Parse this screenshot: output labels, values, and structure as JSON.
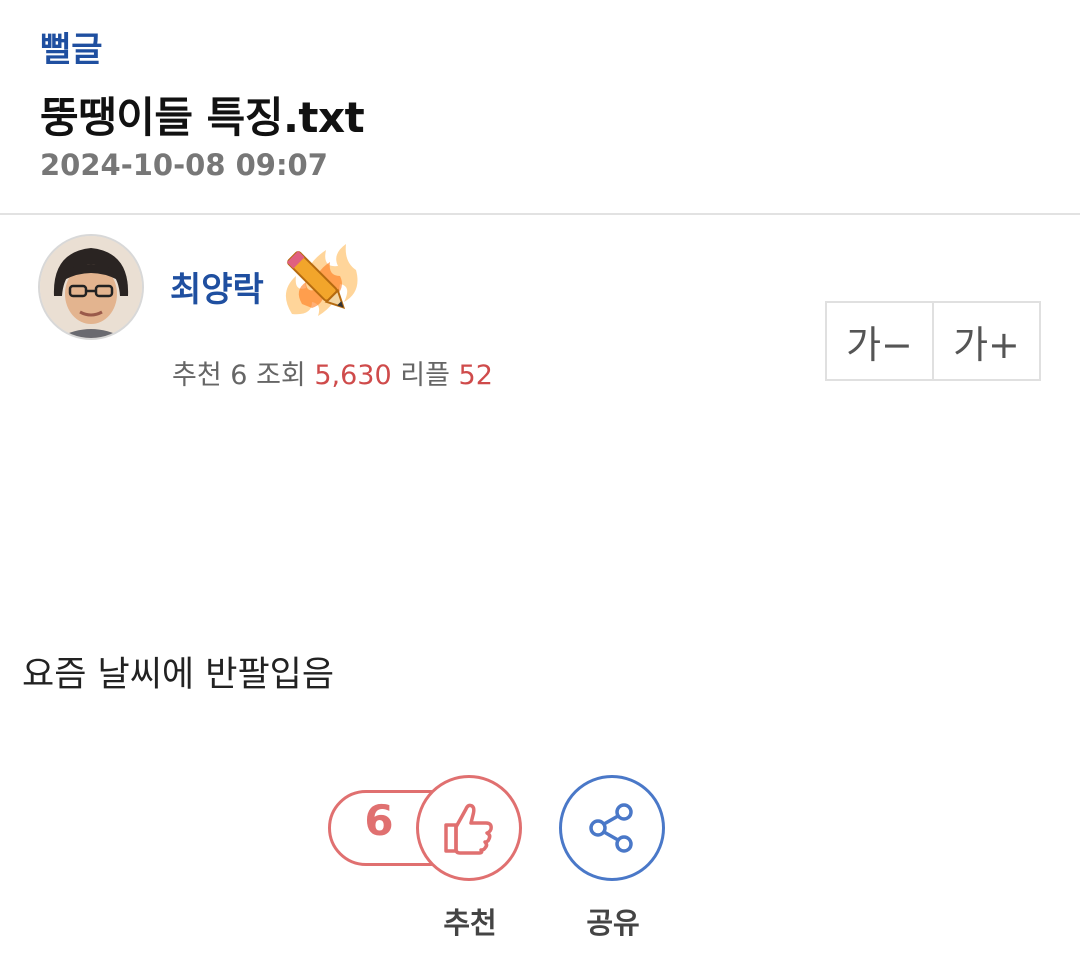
{
  "post": {
    "board": "뻘글",
    "title": "뚱땡이들 특징.txt",
    "date": "2024-10-08 09:07"
  },
  "author": {
    "name": "최양락",
    "badge_icon": "flaming-pencil-icon"
  },
  "stats": {
    "recommend_label": "추천",
    "recommend_count": "6",
    "views_label": "조회",
    "views_count": "5,630",
    "replies_label": "리플",
    "replies_count": "52"
  },
  "font_controls": {
    "decrease": "가−",
    "increase": "가+"
  },
  "content": {
    "text": "요즘 날씨에 반팔입음"
  },
  "actions": {
    "recommend_count": "6",
    "recommend_label": "추천",
    "share_label": "공유"
  },
  "colors": {
    "accent_blue": "#1f4fa0",
    "accent_red": "#e07070",
    "share_blue": "#4a78c8"
  }
}
